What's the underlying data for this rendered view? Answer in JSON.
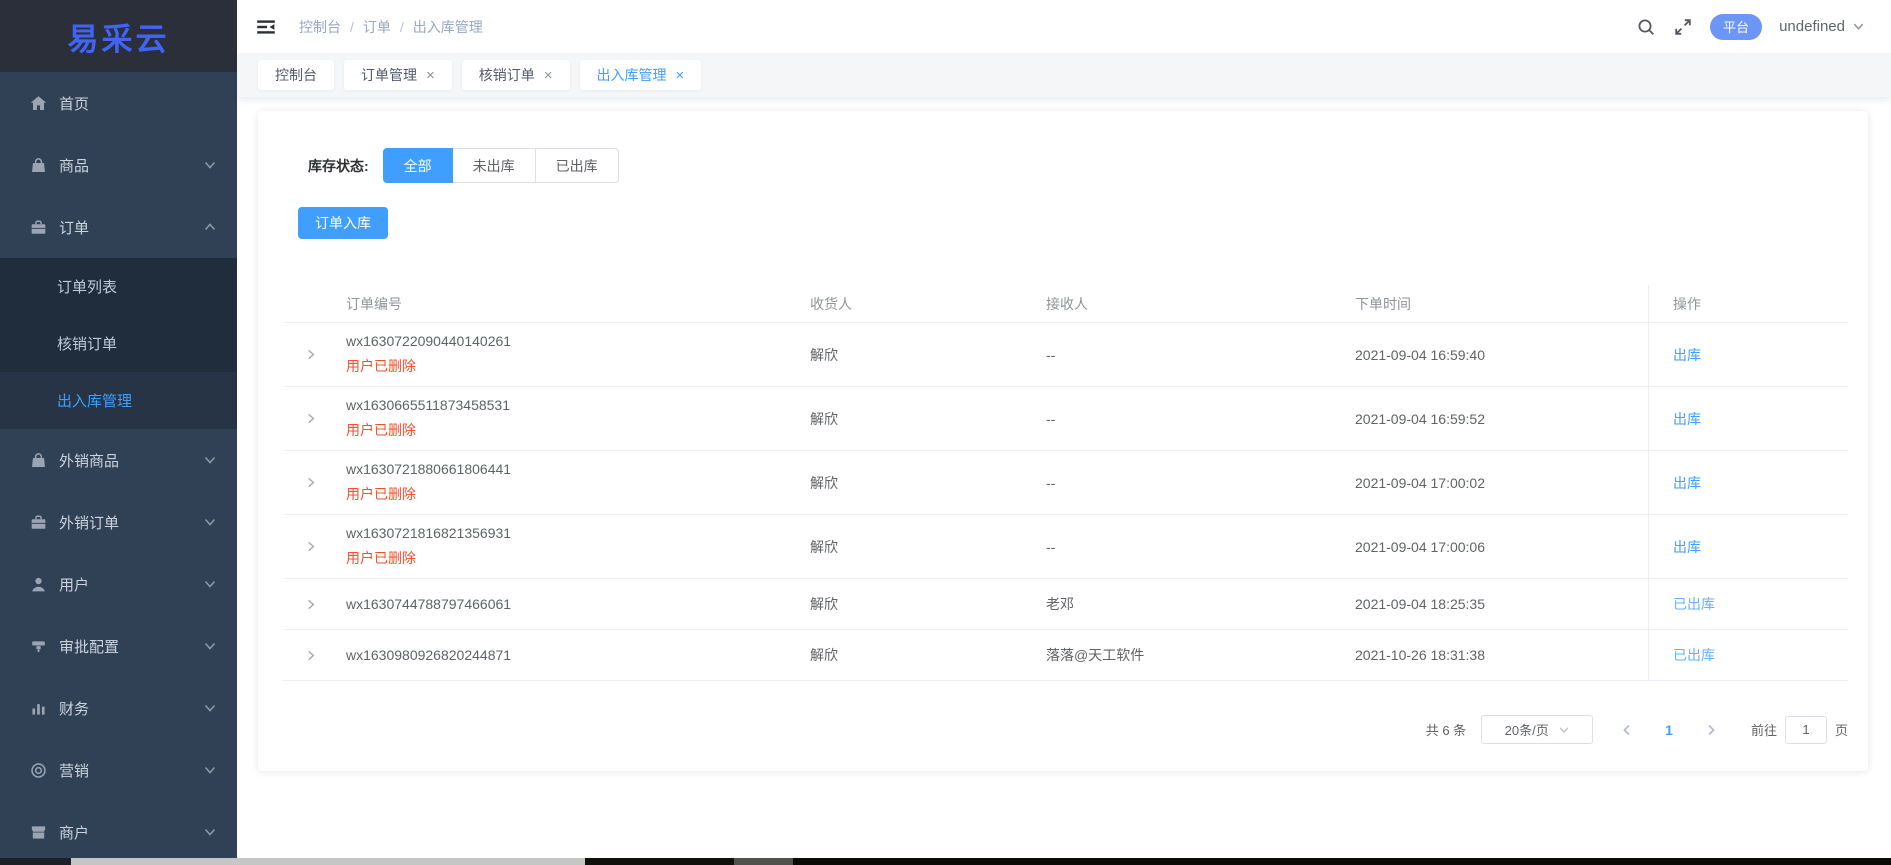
{
  "app": {
    "logo": "易采云"
  },
  "colors": {
    "accent": "#409eff",
    "logo_blue": "#4164f6",
    "danger_text": "#f4502c",
    "done_link": "#66b1ff",
    "badge_bg": "#6b96f7",
    "sidebar_bg": "#304156",
    "submenu_bg": "#1f2d3d"
  },
  "sidebar": {
    "items": [
      {
        "id": "home",
        "label": "首页",
        "icon": "home-icon",
        "chevron": null
      },
      {
        "id": "goods",
        "label": "商品",
        "icon": "bag-icon",
        "chevron": "down"
      },
      {
        "id": "orders",
        "label": "订单",
        "icon": "briefcase-icon",
        "chevron": "up",
        "children": [
          {
            "id": "order-list",
            "label": "订单列表",
            "active": false
          },
          {
            "id": "verify-orders",
            "label": "核销订单",
            "active": false
          },
          {
            "id": "warehouse-management",
            "label": "出入库管理",
            "active": true
          }
        ]
      },
      {
        "id": "export-goods",
        "label": "外销商品",
        "icon": "bag-icon",
        "chevron": "down"
      },
      {
        "id": "export-orders",
        "label": "外销订单",
        "icon": "briefcase-icon",
        "chevron": "down"
      },
      {
        "id": "users",
        "label": "用户",
        "icon": "user-icon",
        "chevron": "down"
      },
      {
        "id": "approval-config",
        "label": "审批配置",
        "icon": "approval-icon",
        "chevron": "down"
      },
      {
        "id": "finance",
        "label": "财务",
        "icon": "finance-icon",
        "chevron": "down"
      },
      {
        "id": "marketing",
        "label": "营销",
        "icon": "marketing-icon",
        "chevron": "down"
      },
      {
        "id": "merchant",
        "label": "商户",
        "icon": "merchant-icon",
        "chevron": "down"
      }
    ]
  },
  "header": {
    "breadcrumb": [
      "控制台",
      "订单",
      "出入库管理"
    ],
    "separator": "/",
    "platform_badge": "平台",
    "user_name": "undefined"
  },
  "tabs": [
    {
      "label": "控制台",
      "closable": false,
      "active": false
    },
    {
      "label": "订单管理",
      "closable": true,
      "active": false
    },
    {
      "label": "核销订单",
      "closable": true,
      "active": false
    },
    {
      "label": "出入库管理",
      "closable": true,
      "active": true
    }
  ],
  "filter": {
    "label": "库存状态:",
    "options": [
      {
        "label": "全部",
        "active": true
      },
      {
        "label": "未出库",
        "active": false
      },
      {
        "label": "已出库",
        "active": false
      }
    ]
  },
  "toolbar": {
    "inbound_button": "订单入库"
  },
  "table": {
    "columns": [
      "订单编号",
      "收货人",
      "接收人",
      "下单时间",
      "操作"
    ],
    "rows": [
      {
        "order_no": "wx1630722090440140261",
        "deleted_note": "用户已删除",
        "consignee": "解欣",
        "receiver": "--",
        "time": "2021-09-04 16:59:40",
        "action": "出库",
        "done": false
      },
      {
        "order_no": "wx1630665511873458531",
        "deleted_note": "用户已删除",
        "consignee": "解欣",
        "receiver": "--",
        "time": "2021-09-04 16:59:52",
        "action": "出库",
        "done": false
      },
      {
        "order_no": "wx1630721880661806441",
        "deleted_note": "用户已删除",
        "consignee": "解欣",
        "receiver": "--",
        "time": "2021-09-04 17:00:02",
        "action": "出库",
        "done": false
      },
      {
        "order_no": "wx1630721816821356931",
        "deleted_note": "用户已删除",
        "consignee": "解欣",
        "receiver": "--",
        "time": "2021-09-04 17:00:06",
        "action": "出库",
        "done": false
      },
      {
        "order_no": "wx1630744788797466061",
        "deleted_note": "",
        "consignee": "解欣",
        "receiver": "老邓",
        "time": "2021-09-04 18:25:35",
        "action": "已出库",
        "done": true
      },
      {
        "order_no": "wx1630980926820244871",
        "deleted_note": "",
        "consignee": "解欣",
        "receiver": "落落@天工软件",
        "time": "2021-10-26 18:31:38",
        "action": "已出库",
        "done": true
      }
    ]
  },
  "pagination": {
    "total": "共 6 条",
    "page_size": "20条/页",
    "current_page": "1",
    "goto_label": "前往",
    "goto_value": "1",
    "page_label": "页"
  }
}
